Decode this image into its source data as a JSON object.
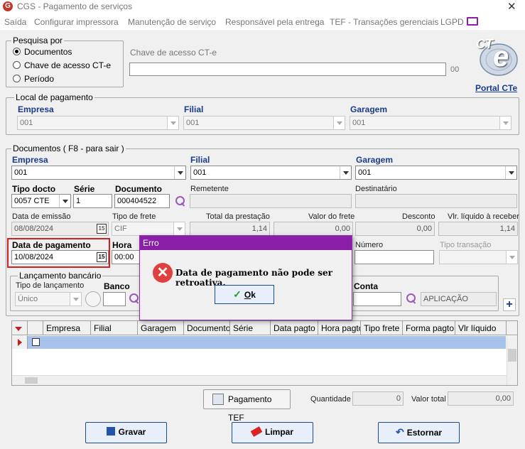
{
  "window": {
    "title": "CGS - Pagamento de serviços",
    "close": "✕"
  },
  "menu": [
    "Saída",
    "Configurar impressora",
    "Manutenção de serviço",
    "Responsável pela entrega",
    "TEF - Transações gerenciais",
    "LGPD"
  ],
  "pesquisa": {
    "legend": "Pesquisa por",
    "options": [
      "Documentos",
      "Chave de acesso CT-e",
      "Período"
    ],
    "selected": "Documentos",
    "chave_label": "Chave de acesso CT-e",
    "chave_value": "",
    "chave_suffix": "00"
  },
  "cte_logo": {
    "text": "CT",
    "letter": "e",
    "link": "Portal CTe"
  },
  "local_pagamento": {
    "legend": "Local de pagamento",
    "empresa_label": "Empresa",
    "empresa_value": "001",
    "filial_label": "Filial",
    "filial_value": "001",
    "garagem_label": "Garagem",
    "garagem_value": "001"
  },
  "documentos": {
    "legend": "Documentos ( F8 - para sair )",
    "empresa_label": "Empresa",
    "empresa_value": "001",
    "filial_label": "Filial",
    "filial_value": "001",
    "garagem_label": "Garagem",
    "garagem_value": "001",
    "tipo_docto_label": "Tipo docto",
    "tipo_docto_value": "0057 CTE",
    "serie_label": "Série",
    "serie_value": "1",
    "documento_label": "Documento",
    "documento_value": "000404522",
    "remetente_label": "Remetente",
    "remetente_value": "",
    "destinatario_label": "Destinatário",
    "destinatario_value": "",
    "data_emissao_label": "Data de emissão",
    "data_emissao_value": "08/08/2024",
    "tipo_frete_label": "Tipo de frete",
    "tipo_frete_value": "CIF",
    "total_prestacao_label": "Total da prestação",
    "total_prestacao_value": "1,14",
    "valor_frete_label": "Valor do frete",
    "valor_frete_value": "0,00",
    "desconto_label": "Desconto",
    "desconto_value": "0,00",
    "vlr_liquido_label": "Vlr. líquido à receber",
    "vlr_liquido_value": "1,14",
    "data_pagamento_label": "Data de pagamento",
    "data_pagamento_value": "10/08/2024",
    "hora_label": "Hora",
    "hora_value": "00:00",
    "numero_label": "Número",
    "numero_value": "",
    "tipo_transacao_label": "Tipo transação",
    "tipo_transacao_value": "",
    "calendar_text": "15"
  },
  "lancamento": {
    "legend": "Lançamento bancário",
    "tipo_label": "Tipo de lançamento",
    "tipo_value": "Único",
    "banco_label": "Banco",
    "banco_value": "",
    "conta_label": "Conta",
    "conta_value": "",
    "aplicacao_value": "APLICAÇÃO",
    "add": "+"
  },
  "grid": {
    "columns": [
      "Empresa",
      "Filial",
      "Garagem",
      "Documento",
      "Série",
      "Data pagto",
      "Hora pagto",
      "Tipo frete",
      "Forma pagto",
      "Vlr líquido"
    ]
  },
  "footer": {
    "pagamento_tef": "Pagamento TEF",
    "quantidade_label": "Quantidade",
    "quantidade_value": "0",
    "valor_total_label": "Valor total",
    "valor_total_value": "0,00",
    "gravar": "Gravar",
    "limpar": "Limpar",
    "estornar": "Estornar"
  },
  "dialog": {
    "title": "Erro",
    "icon": "x-icon",
    "message": "Data de pagamento não pode ser retroativa.",
    "ok_underlined": "O",
    "ok_rest": "k"
  },
  "colors": {
    "dialog_title": "#8b1fa8",
    "highlight": "#d42020",
    "selected_row": "#a7c3ec"
  }
}
